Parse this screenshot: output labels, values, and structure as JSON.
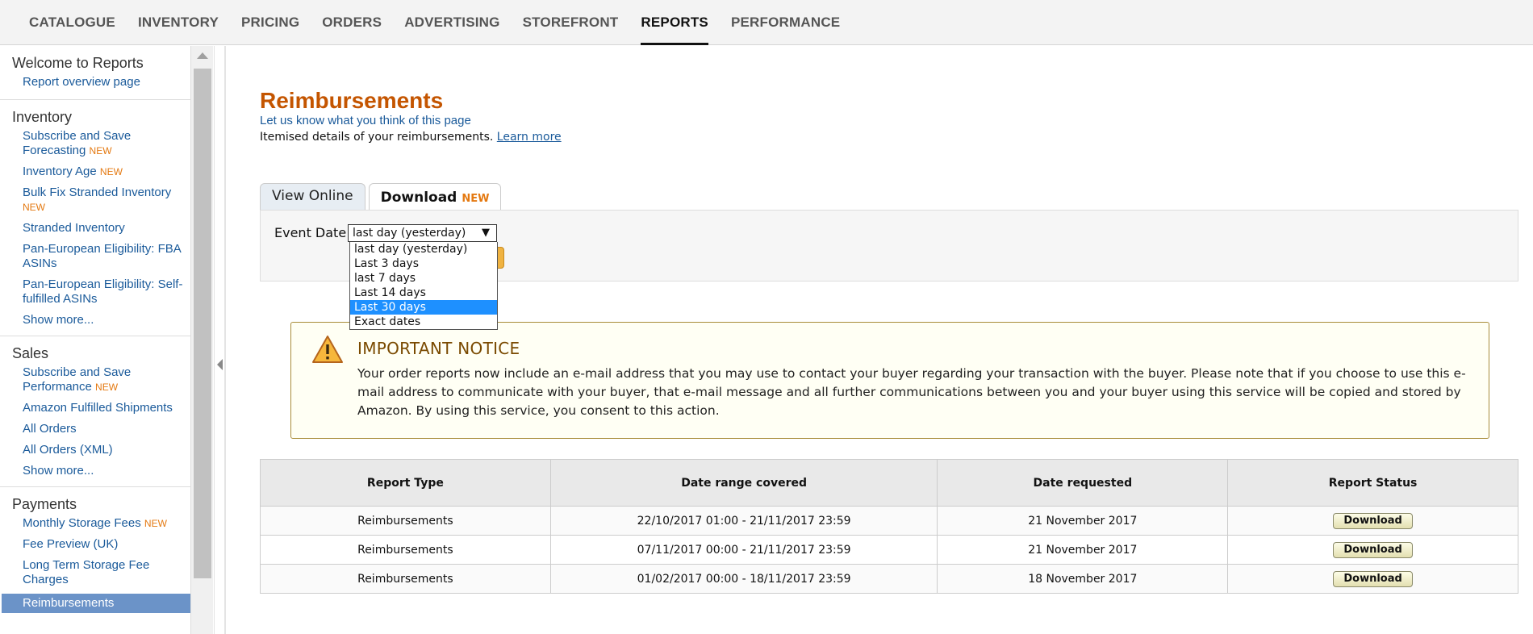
{
  "topnav": {
    "items": [
      "CATALOGUE",
      "INVENTORY",
      "PRICING",
      "ORDERS",
      "ADVERTISING",
      "STOREFRONT",
      "REPORTS",
      "PERFORMANCE"
    ],
    "active": "REPORTS"
  },
  "sidebar": {
    "welcome": {
      "title": "Welcome to Reports",
      "items": [
        "Report overview page"
      ]
    },
    "inventory": {
      "title": "Inventory",
      "items": [
        {
          "label": "Subscribe and Save Forecasting",
          "badge": "NEW"
        },
        {
          "label": "Inventory Age",
          "badge": "NEW"
        },
        {
          "label": "Bulk Fix Stranded Inventory",
          "badge": "NEW"
        },
        {
          "label": "Stranded Inventory"
        },
        {
          "label": "Pan-European Eligibility: FBA ASINs"
        },
        {
          "label": "Pan-European Eligibility: Self-fulfilled ASINs"
        },
        {
          "label": "Show more..."
        }
      ]
    },
    "sales": {
      "title": "Sales",
      "items": [
        {
          "label": "Subscribe and Save Performance",
          "badge": "NEW"
        },
        {
          "label": "Amazon Fulfilled Shipments"
        },
        {
          "label": "All Orders"
        },
        {
          "label": "All Orders (XML)"
        },
        {
          "label": "Show more..."
        }
      ]
    },
    "payments": {
      "title": "Payments",
      "items": [
        {
          "label": "Monthly Storage Fees",
          "badge": "NEW"
        },
        {
          "label": "Fee Preview (UK)"
        },
        {
          "label": "Long Term Storage Fee Charges"
        },
        {
          "label": "Reimbursements"
        }
      ]
    }
  },
  "main": {
    "title": "Reimbursements",
    "feedback": "Let us know what you think of this page",
    "subtitle": "Itemised details of your reimbursements.",
    "learn_more": "Learn more",
    "tabs": {
      "view_online": "View Online",
      "download": "Download",
      "download_badge": "NEW"
    },
    "filter": {
      "label": "Event Date",
      "selected": "last day (yesterday)",
      "options": [
        "last day (yesterday)",
        "Last 3 days",
        "last 7 days",
        "Last 14 days",
        "Last 30 days",
        "Exact dates"
      ],
      "highlighted": "Last 30 days"
    },
    "notice": {
      "title": "IMPORTANT NOTICE",
      "body": "Your order reports now include an e-mail address that you may use to contact your buyer regarding your transaction with the buyer. Please note that if you choose to use this e-mail address to communicate with your buyer, that e-mail message and all further communications between you and your buyer using this service will be copied and stored by Amazon. By using this service, you consent to this action."
    },
    "table": {
      "headers": [
        "Report Type",
        "Date range covered",
        "Date requested",
        "Report Status"
      ],
      "rows": [
        {
          "type": "Reimbursements",
          "range": "22/10/2017 01:00 - 21/11/2017 23:59",
          "requested": "21 November 2017",
          "status": "Download"
        },
        {
          "type": "Reimbursements",
          "range": "07/11/2017 00:00 - 21/11/2017 23:59",
          "requested": "21 November 2017",
          "status": "Download"
        },
        {
          "type": "Reimbursements",
          "range": "01/02/2017 00:00 - 18/11/2017 23:59",
          "requested": "18 November 2017",
          "status": "Download"
        }
      ]
    }
  }
}
